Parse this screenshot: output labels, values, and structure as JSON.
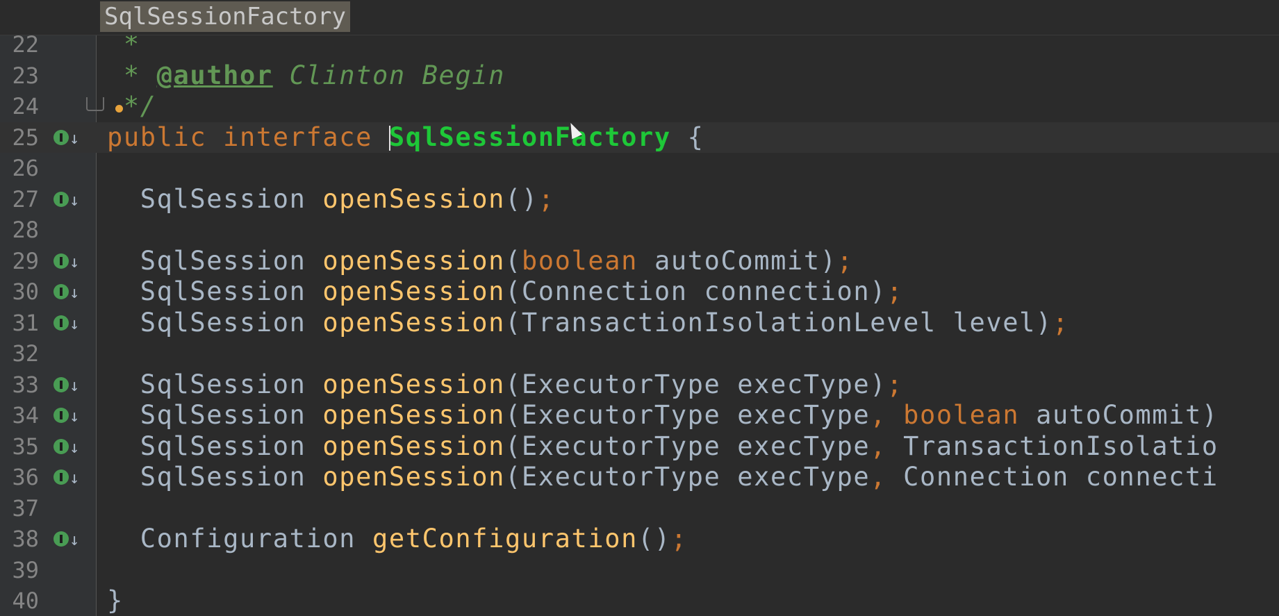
{
  "breadcrumb": {
    "label": "SqlSessionFactory"
  },
  "editor": {
    "lines": [
      {
        "no": "22",
        "marker": false,
        "segments": [
          {
            "t": " *",
            "c": "cm"
          }
        ]
      },
      {
        "no": "23",
        "marker": false,
        "segments": [
          {
            "t": " * ",
            "c": "cm"
          },
          {
            "t": "@author",
            "c": "tag"
          },
          {
            "t": " Clinton Begin",
            "c": "cm"
          }
        ]
      },
      {
        "no": "24",
        "marker": false,
        "segments": [
          {
            "t": " */",
            "c": "cm"
          }
        ]
      },
      {
        "no": "25",
        "marker": true,
        "current": true,
        "segments": [
          {
            "t": "public interface ",
            "c": "kw"
          },
          {
            "t": "SqlSessionFactory",
            "c": "iface",
            "caret": true
          },
          {
            "t": " {",
            "c": "ty"
          }
        ]
      },
      {
        "no": "26",
        "marker": false,
        "segments": []
      },
      {
        "no": "27",
        "marker": true,
        "segments": [
          {
            "t": "  SqlSession ",
            "c": "ty"
          },
          {
            "t": "openSession",
            "c": "fn"
          },
          {
            "t": "()",
            "c": "ty"
          },
          {
            "t": ";",
            "c": "kw"
          }
        ]
      },
      {
        "no": "28",
        "marker": false,
        "segments": []
      },
      {
        "no": "29",
        "marker": true,
        "segments": [
          {
            "t": "  SqlSession ",
            "c": "ty"
          },
          {
            "t": "openSession",
            "c": "fn"
          },
          {
            "t": "(",
            "c": "ty"
          },
          {
            "t": "boolean",
            "c": "kw"
          },
          {
            "t": " autoCommit)",
            "c": "ty"
          },
          {
            "t": ";",
            "c": "kw"
          }
        ]
      },
      {
        "no": "30",
        "marker": true,
        "segments": [
          {
            "t": "  SqlSession ",
            "c": "ty"
          },
          {
            "t": "openSession",
            "c": "fn"
          },
          {
            "t": "(Connection connection)",
            "c": "ty"
          },
          {
            "t": ";",
            "c": "kw"
          }
        ]
      },
      {
        "no": "31",
        "marker": true,
        "segments": [
          {
            "t": "  SqlSession ",
            "c": "ty"
          },
          {
            "t": "openSession",
            "c": "fn"
          },
          {
            "t": "(TransactionIsolationLevel level)",
            "c": "ty"
          },
          {
            "t": ";",
            "c": "kw"
          }
        ]
      },
      {
        "no": "32",
        "marker": false,
        "segments": []
      },
      {
        "no": "33",
        "marker": true,
        "segments": [
          {
            "t": "  SqlSession ",
            "c": "ty"
          },
          {
            "t": "openSession",
            "c": "fn"
          },
          {
            "t": "(ExecutorType execType)",
            "c": "ty"
          },
          {
            "t": ";",
            "c": "kw"
          }
        ]
      },
      {
        "no": "34",
        "marker": true,
        "segments": [
          {
            "t": "  SqlSession ",
            "c": "ty"
          },
          {
            "t": "openSession",
            "c": "fn"
          },
          {
            "t": "(ExecutorType execType",
            "c": "ty"
          },
          {
            "t": ", ",
            "c": "kw"
          },
          {
            "t": "boolean",
            "c": "kw"
          },
          {
            "t": " autoCommit)",
            "c": "ty"
          }
        ]
      },
      {
        "no": "35",
        "marker": true,
        "segments": [
          {
            "t": "  SqlSession ",
            "c": "ty"
          },
          {
            "t": "openSession",
            "c": "fn"
          },
          {
            "t": "(ExecutorType execType",
            "c": "ty"
          },
          {
            "t": ", ",
            "c": "kw"
          },
          {
            "t": "TransactionIsolatio",
            "c": "ty"
          }
        ]
      },
      {
        "no": "36",
        "marker": true,
        "segments": [
          {
            "t": "  SqlSession ",
            "c": "ty"
          },
          {
            "t": "openSession",
            "c": "fn"
          },
          {
            "t": "(ExecutorType execType",
            "c": "ty"
          },
          {
            "t": ", ",
            "c": "kw"
          },
          {
            "t": "Connection connecti",
            "c": "ty"
          }
        ]
      },
      {
        "no": "37",
        "marker": false,
        "segments": []
      },
      {
        "no": "38",
        "marker": true,
        "segments": [
          {
            "t": "  Configuration ",
            "c": "ty"
          },
          {
            "t": "getConfiguration",
            "c": "fn"
          },
          {
            "t": "()",
            "c": "ty"
          },
          {
            "t": ";",
            "c": "kw"
          }
        ]
      },
      {
        "no": "39",
        "marker": false,
        "segments": []
      },
      {
        "no": "40",
        "marker": false,
        "segments": [
          {
            "t": "}",
            "c": "ty"
          }
        ]
      }
    ]
  },
  "icons": {
    "implementation_marker": "implemented-method-icon",
    "fold": "fold-icon",
    "intention": "lightbulb-icon",
    "mouse_cursor": "mouse-pointer-icon"
  },
  "colors": {
    "background": "#2b2b2b",
    "keyword": "#cc7832",
    "method": "#ffc66d",
    "interface_highlight": "#1ec838",
    "comment": "#629755",
    "plain": "#a9b7c6",
    "marker": "#499c54"
  }
}
